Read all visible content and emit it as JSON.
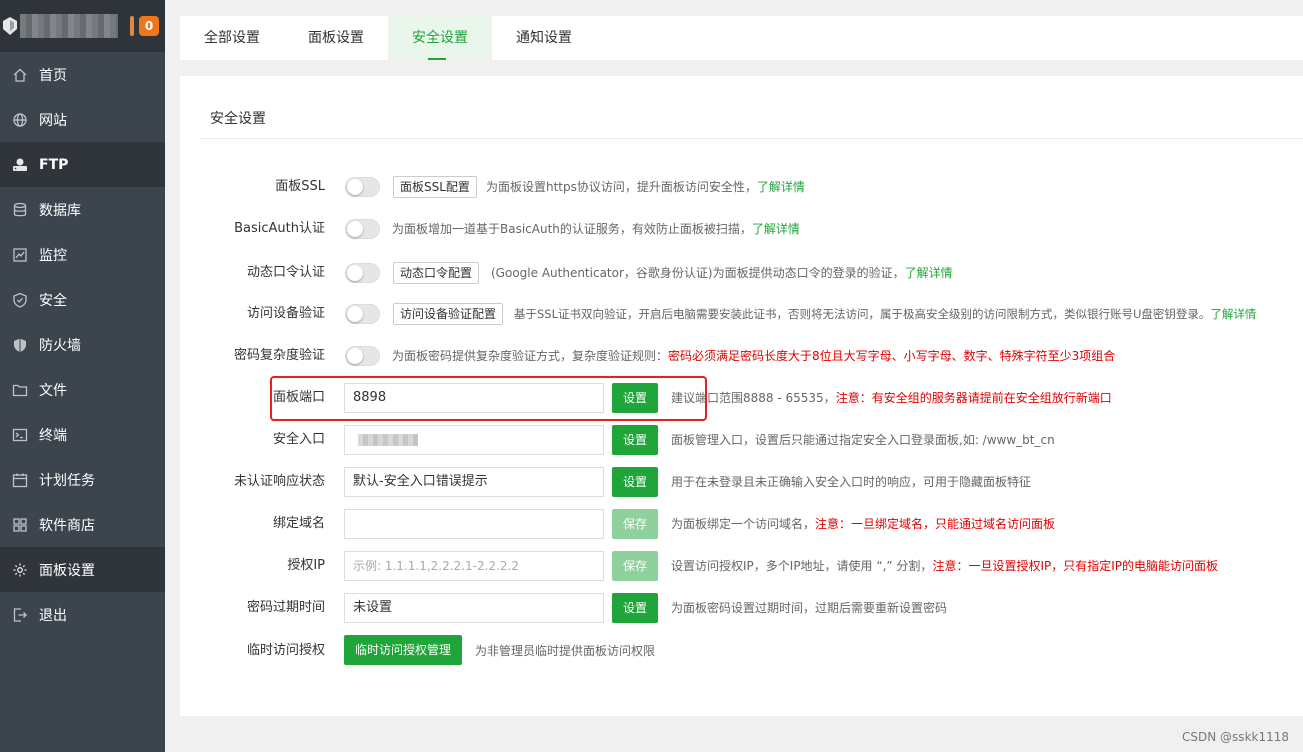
{
  "sidebar": {
    "badge": "0",
    "items": [
      {
        "label": "首页",
        "icon": "home-icon"
      },
      {
        "label": "网站",
        "icon": "globe-icon"
      },
      {
        "label": "FTP",
        "icon": "ftp-icon"
      },
      {
        "label": "数据库",
        "icon": "database-icon"
      },
      {
        "label": "监控",
        "icon": "monitor-icon"
      },
      {
        "label": "安全",
        "icon": "shield-icon"
      },
      {
        "label": "防火墙",
        "icon": "firewall-icon"
      },
      {
        "label": "文件",
        "icon": "folder-icon"
      },
      {
        "label": "终端",
        "icon": "terminal-icon"
      },
      {
        "label": "计划任务",
        "icon": "calendar-icon"
      },
      {
        "label": "软件商店",
        "icon": "apps-icon"
      },
      {
        "label": "面板设置",
        "icon": "gear-icon"
      },
      {
        "label": "退出",
        "icon": "logout-icon"
      }
    ]
  },
  "tabs": [
    "全部设置",
    "面板设置",
    "安全设置",
    "通知设置"
  ],
  "active_tab": "安全设置",
  "panel": {
    "title": "安全设置",
    "ssl": {
      "label": "面板SSL",
      "button": "面板SSL配置",
      "desc": "为面板设置https协议访问，提升面板访问安全性，",
      "link": "了解详情"
    },
    "basicauth": {
      "label": "BasicAuth认证",
      "desc": "为面板增加一道基于BasicAuth的认证服务，有效防止面板被扫描，",
      "link": "了解详情"
    },
    "otp": {
      "label": "动态口令认证",
      "button": "动态口令配置",
      "desc": "(Google Authenticator，谷歌身份认证)为面板提供动态口令的登录的验证，",
      "link": "了解详情"
    },
    "device": {
      "label": "访问设备验证",
      "button": "访问设备验证配置",
      "desc": "基于SSL证书双向验证，开启后电脑需要安装此证书，否则将无法访问，属于极高安全级别的访问限制方式，类似银行账号U盘密钥登录。",
      "link": "了解详情"
    },
    "pwcomplex": {
      "label": "密码复杂度验证",
      "desc": "为面板密码提供复杂度验证方式，复杂度验证规则：",
      "warn": "密码必须满足密码长度大于8位且大写字母、小写字母、数字、特殊字符至少3项组合"
    },
    "port": {
      "label": "面板端口",
      "value": "8898",
      "button": "设置",
      "desc": "建议端口范围8888 - 65535，",
      "warn": "注意：有安全组的服务器请提前在安全组放行新端口"
    },
    "entry": {
      "label": "安全入口",
      "button": "设置",
      "desc": "面板管理入口，设置后只能通过指定安全入口登录面板,如: /www_bt_cn"
    },
    "unauth": {
      "label": "未认证响应状态",
      "value": "默认-安全入口错误提示",
      "button": "设置",
      "desc": "用于在未登录且未正确输入安全入口时的响应，可用于隐藏面板特征"
    },
    "domain": {
      "label": "绑定域名",
      "value": "",
      "button": "保存",
      "desc": "为面板绑定一个访问域名，",
      "warn": "注意：一旦绑定域名，只能通过域名访问面板"
    },
    "authip": {
      "label": "授权IP",
      "placeholder": "示例: 1.1.1.1,2.2.2.1-2.2.2.2",
      "button": "保存",
      "desc": "设置访问授权IP，多个IP地址，请使用 “,” 分割，",
      "warn": "注意：一旦设置授权IP，只有指定IP的电脑能访问面板"
    },
    "pwexpire": {
      "label": "密码过期时间",
      "value": "未设置",
      "button": "设置",
      "desc": "为面板密码设置过期时间，过期后需要重新设置密码"
    },
    "tempauth": {
      "label": "临时访问授权",
      "button": "临时访问授权管理",
      "desc": "为非管理员临时提供面板访问权限"
    }
  },
  "watermark": "CSDN @sskk1118",
  "colors": {
    "accent": "#20a53a",
    "sidebar": "#3c444d",
    "warning": "#e00000",
    "badge": "#f0761c"
  }
}
